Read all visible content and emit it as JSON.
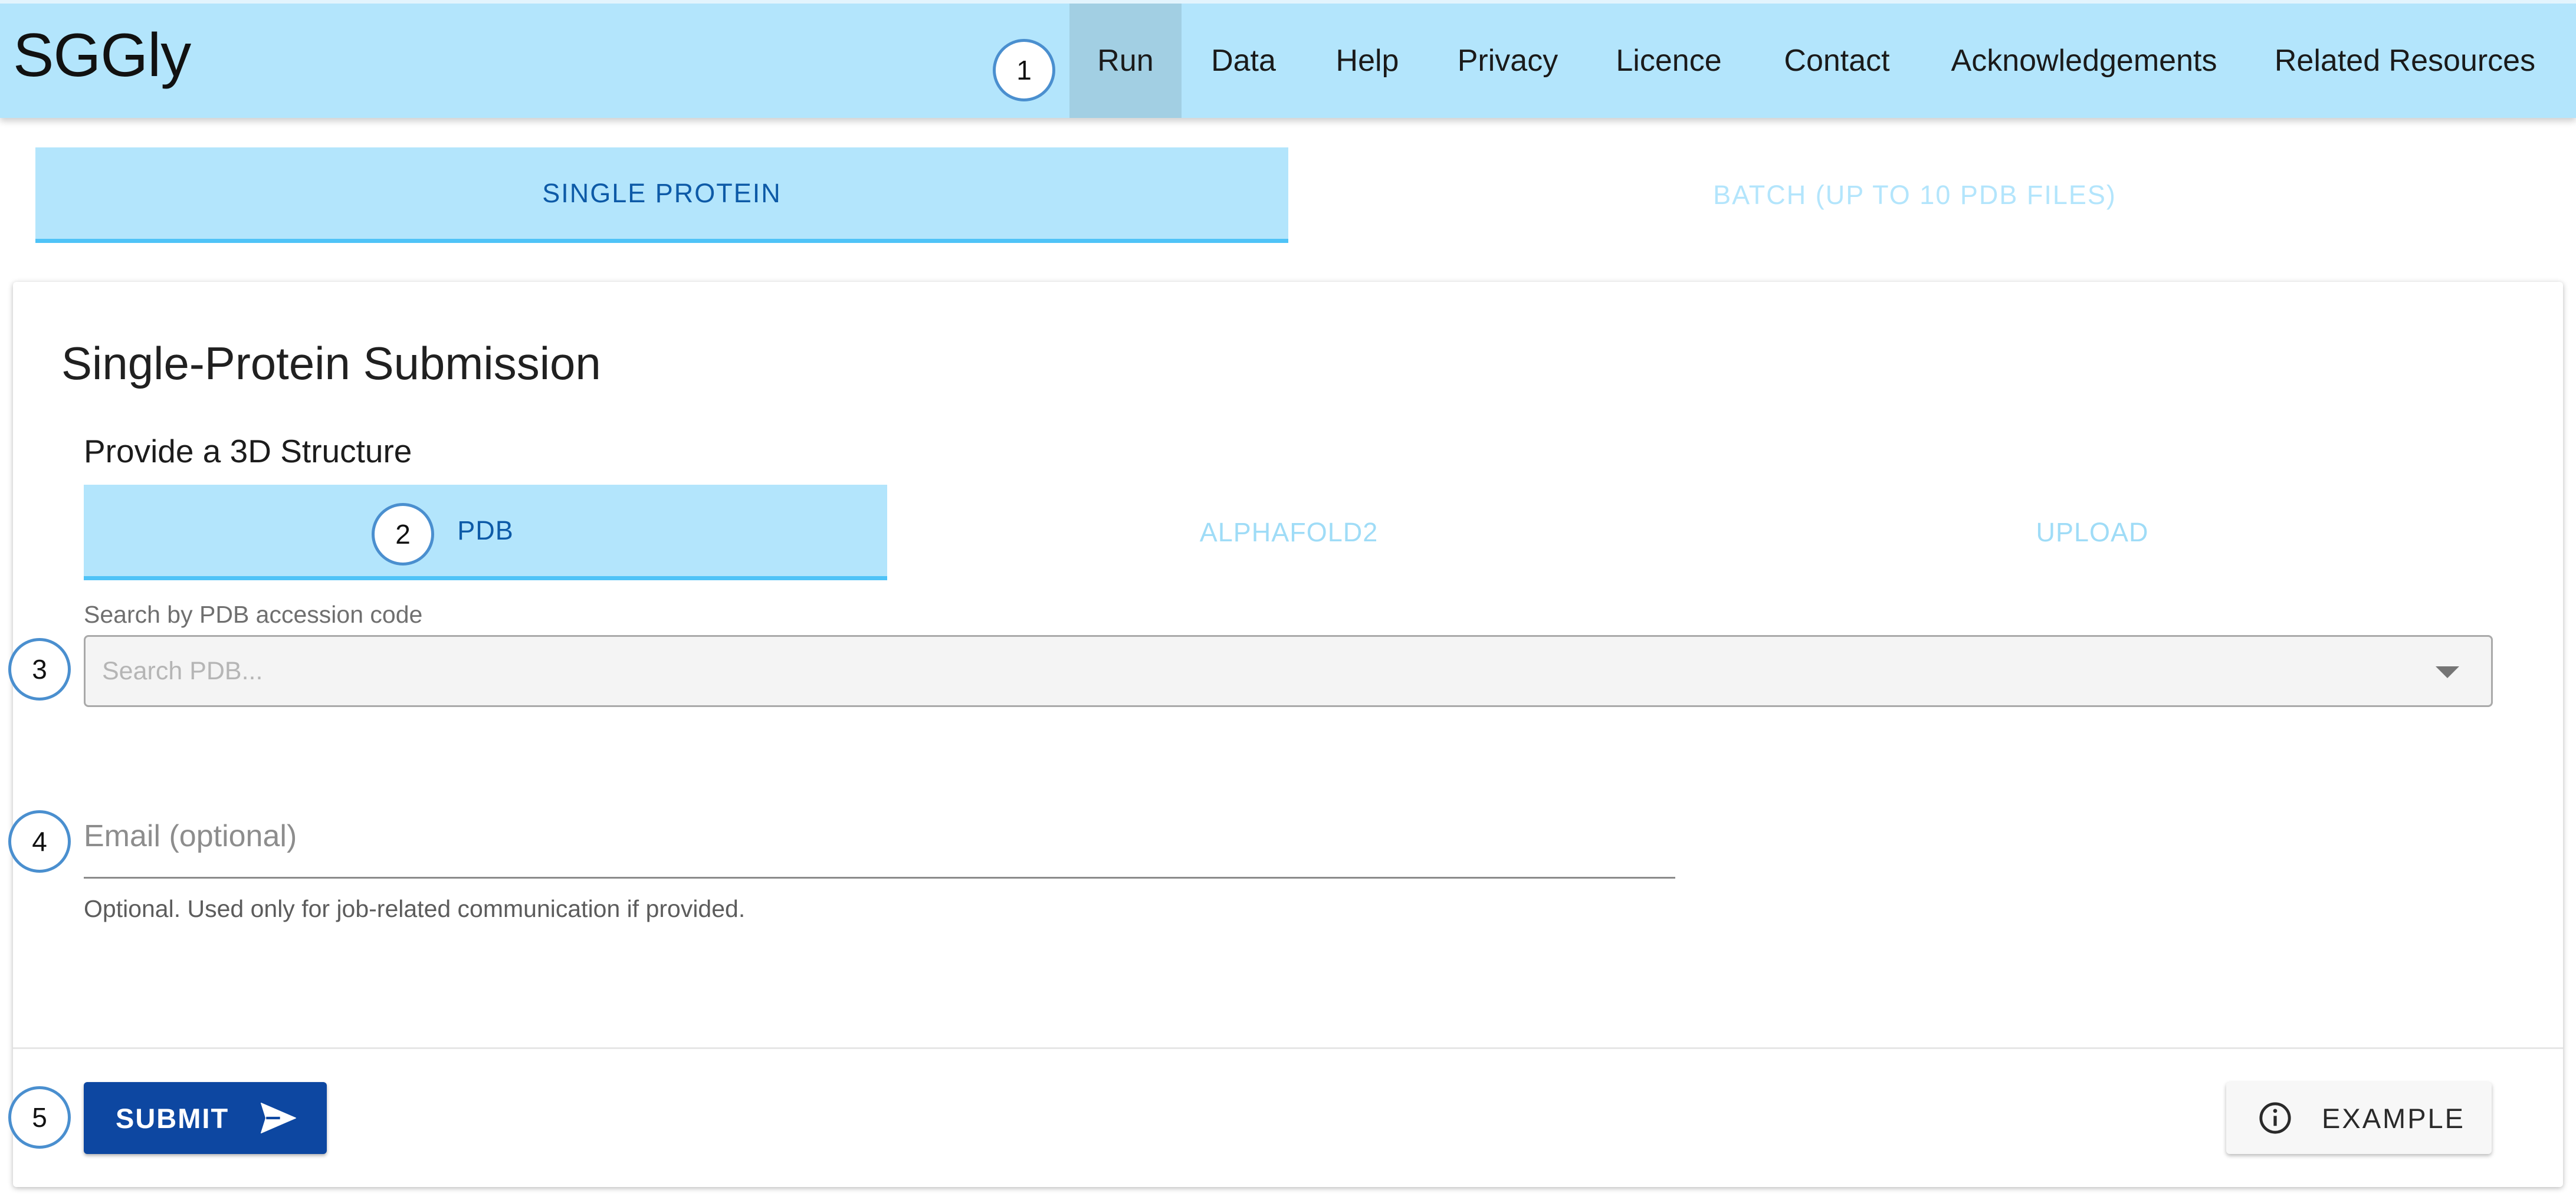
{
  "app": {
    "title": "SGGly"
  },
  "nav": {
    "items": [
      {
        "label": "Run",
        "active": true
      },
      {
        "label": "Data"
      },
      {
        "label": "Help"
      },
      {
        "label": "Privacy"
      },
      {
        "label": "Licence"
      },
      {
        "label": "Contact"
      },
      {
        "label": "Acknowledgements"
      },
      {
        "label": "Related Resources"
      }
    ]
  },
  "mode_tabs": [
    {
      "label": "SINGLE PROTEIN",
      "active": true
    },
    {
      "label": "BATCH (UP TO 10 PDB FILES)",
      "active": false
    }
  ],
  "form": {
    "title": "Single-Protein Submission",
    "structure_label": "Provide a 3D Structure",
    "source_tabs": [
      {
        "label": "PDB",
        "active": true
      },
      {
        "label": "ALPHAFOLD2",
        "active": false
      },
      {
        "label": "UPLOAD",
        "active": false
      }
    ],
    "search": {
      "label": "Search by PDB accession code",
      "placeholder": "Search PDB...",
      "value": ""
    },
    "email": {
      "placeholder": "Email (optional)",
      "value": "",
      "helper": "Optional. Used only for job-related communication if provided."
    },
    "submit_label": "SUBMIT",
    "example_label": "EXAMPLE"
  },
  "annotations": [
    "1",
    "2",
    "3",
    "4",
    "5"
  ],
  "colors": {
    "navbar_bg": "#b3e5fc",
    "nav_active_bg": "#a2cfe3",
    "tab_active_text": "#0d5aa7",
    "tab_indicator": "#4fc3f7",
    "submit_bg": "#0d47a1",
    "marker_border": "#4a8fcf"
  },
  "icons": {
    "submit": "send-icon",
    "example": "info-icon",
    "search_dropdown": "caret-down-icon"
  }
}
